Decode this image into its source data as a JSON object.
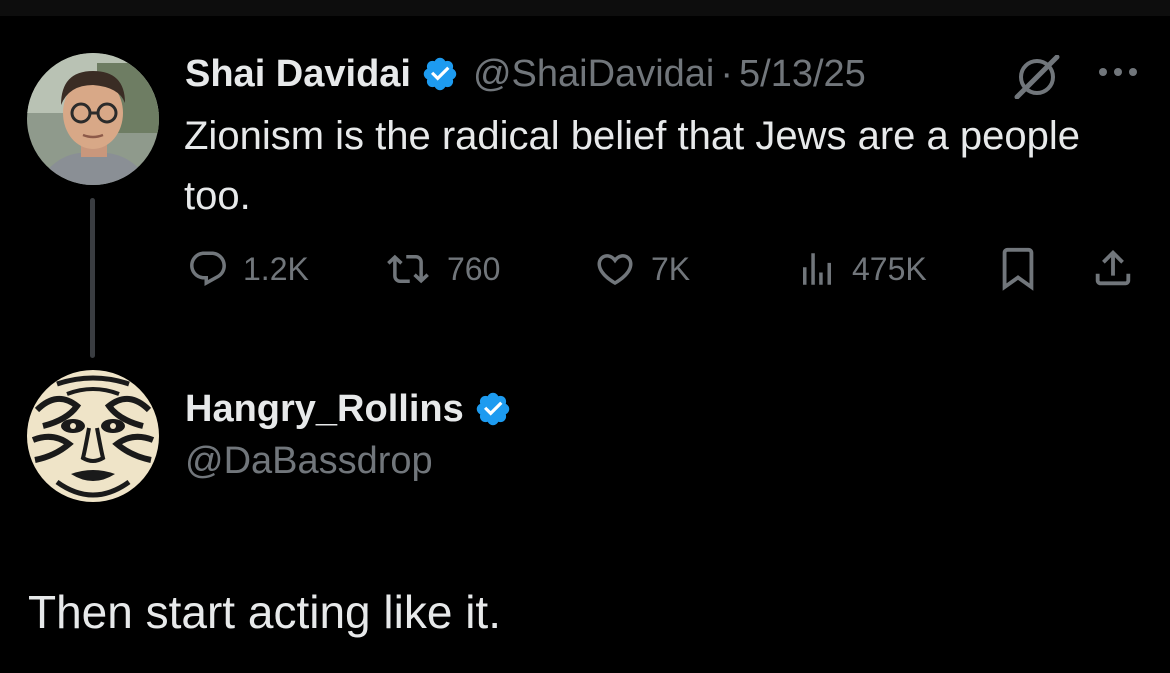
{
  "original_tweet": {
    "author": {
      "display_name": "Shai Davidai",
      "handle": "@ShaiDavidai",
      "verified": true
    },
    "separator": "·",
    "date": "5/13/25",
    "text": "Zionism is the radical belief that Jews are a people too.",
    "metrics": {
      "replies": "1.2K",
      "reposts": "760",
      "likes": "7K",
      "views": "475K"
    },
    "icons": [
      "grok-icon",
      "more-options-icon",
      "reply-icon",
      "repost-icon",
      "like-icon",
      "views-icon",
      "bookmark-icon",
      "share-icon"
    ]
  },
  "reply_tweet": {
    "author": {
      "display_name": "Hangry_Rollins",
      "handle": "@DaBassdrop",
      "verified": true
    },
    "text": "Then start acting like it."
  },
  "colors": {
    "background": "#000000",
    "primary_text": "#e7e9ea",
    "secondary_text": "#71767b",
    "verified_badge": "#1d9bf0",
    "thread_line": "#3a3d41"
  }
}
